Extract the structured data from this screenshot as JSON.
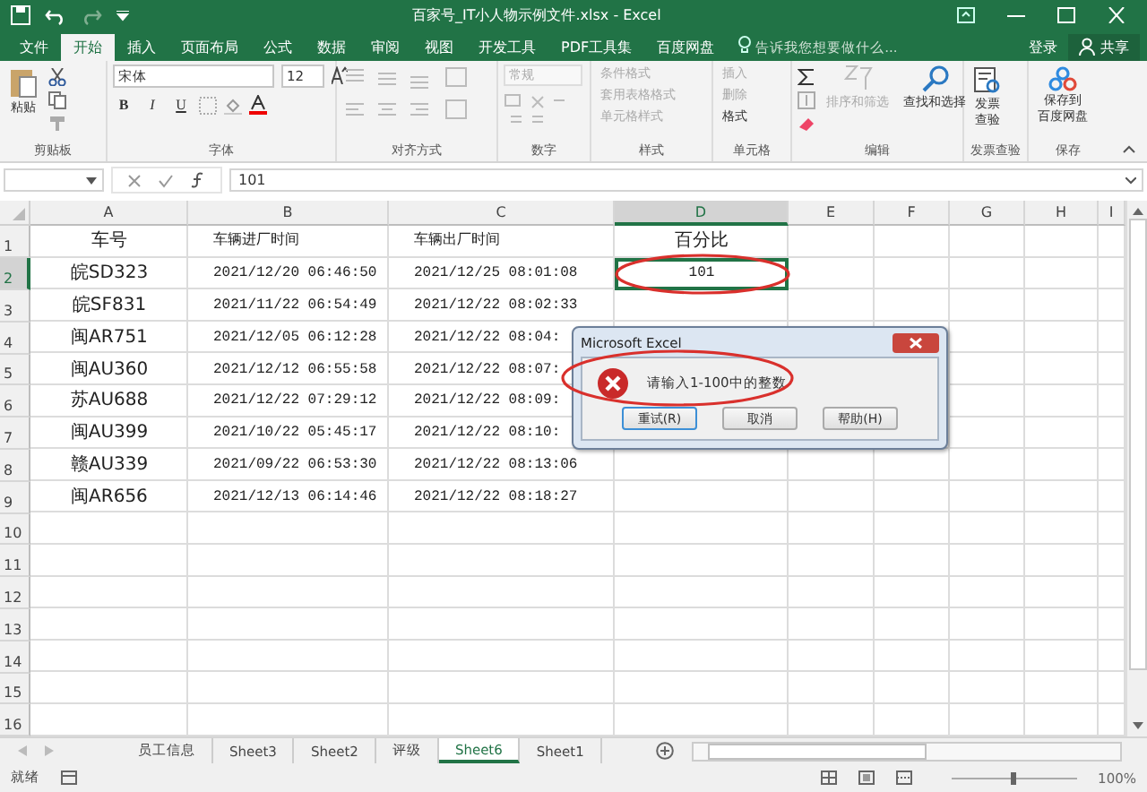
{
  "window": {
    "title": "百家号_IT小人物示例文件.xlsx - Excel"
  },
  "ribbon_tabs": [
    {
      "label": "文件",
      "selected": false
    },
    {
      "label": "开始",
      "selected": true
    },
    {
      "label": "插入",
      "selected": false
    },
    {
      "label": "页面布局",
      "selected": false
    },
    {
      "label": "公式",
      "selected": false
    },
    {
      "label": "数据",
      "selected": false
    },
    {
      "label": "审阅",
      "selected": false
    },
    {
      "label": "视图",
      "selected": false
    },
    {
      "label": "开发工具",
      "selected": false
    },
    {
      "label": "PDF工具集",
      "selected": false
    },
    {
      "label": "百度网盘",
      "selected": false
    }
  ],
  "tell_me": {
    "placeholder": "告诉我您想要做什么..."
  },
  "account": {
    "login": "登录",
    "share": "共享"
  },
  "ribbon": {
    "clipboard": {
      "label": "剪贴板",
      "paste": "粘贴"
    },
    "font": {
      "label": "字体",
      "font_name": "宋体",
      "font_size": "12",
      "bold": "B",
      "italic": "I",
      "underline": "U"
    },
    "alignment": {
      "label": "对齐方式"
    },
    "number": {
      "label": "数字",
      "format": "常规"
    },
    "styles": {
      "label": "样式",
      "items": [
        {
          "label": "条件格式",
          "disabled": true
        },
        {
          "label": "套用表格格式",
          "disabled": true
        },
        {
          "label": "单元格样式",
          "disabled": true
        }
      ]
    },
    "cells": {
      "label": "单元格",
      "items": [
        {
          "label": "插入",
          "disabled": true
        },
        {
          "label": "删除",
          "disabled": true
        },
        {
          "label": "格式",
          "disabled": false
        }
      ]
    },
    "editing": {
      "label": "编辑",
      "items": [
        {
          "label": "排序和筛选",
          "disabled": true
        },
        {
          "label": "查找和选择",
          "disabled": false
        }
      ]
    },
    "invoice": {
      "label": "发票查验",
      "button": [
        "发票",
        "查验"
      ]
    },
    "save": {
      "label": "保存",
      "button": [
        "保存到",
        "百度网盘"
      ]
    }
  },
  "formula_bar": {
    "value": "101"
  },
  "columns": [
    {
      "label": "A",
      "selected": false
    },
    {
      "label": "B",
      "selected": false
    },
    {
      "label": "C",
      "selected": false
    },
    {
      "label": "D",
      "selected": true
    },
    {
      "label": "E",
      "selected": false
    },
    {
      "label": "F",
      "selected": false
    },
    {
      "label": "G",
      "selected": false
    },
    {
      "label": "H",
      "selected": false
    },
    {
      "label": "I",
      "selected": false
    }
  ],
  "rows": [
    {
      "header": "1",
      "selected": false,
      "cells": [
        {
          "text": "车号",
          "active": false
        },
        {
          "text": "车辆进厂时间",
          "active": false
        },
        {
          "text": "车辆出厂时间",
          "active": false
        },
        {
          "text": "百分比",
          "active": false
        }
      ]
    },
    {
      "header": "2",
      "selected": true,
      "cells": [
        {
          "text": "皖SD323",
          "active": false
        },
        {
          "text": "2021/12/20 06:46:50",
          "active": false
        },
        {
          "text": "2021/12/25 08:01:08",
          "active": false
        },
        {
          "text": "101",
          "active": true
        }
      ]
    },
    {
      "header": "3",
      "selected": false,
      "cells": [
        {
          "text": "皖SF831",
          "active": false
        },
        {
          "text": "2021/11/22 06:54:49",
          "active": false
        },
        {
          "text": "2021/12/22 08:02:33",
          "active": false
        }
      ]
    },
    {
      "header": "4",
      "selected": false,
      "cells": [
        {
          "text": "闽AR751",
          "active": false
        },
        {
          "text": "2021/12/05 06:12:28",
          "active": false
        },
        {
          "text": "2021/12/22 08:04:",
          "active": false
        }
      ]
    },
    {
      "header": "5",
      "selected": false,
      "cells": [
        {
          "text": "闽AU360",
          "active": false
        },
        {
          "text": "2021/12/12 06:55:58",
          "active": false
        },
        {
          "text": "2021/12/22 08:07:",
          "active": false
        }
      ]
    },
    {
      "header": "6",
      "selected": false,
      "cells": [
        {
          "text": "苏AU688",
          "active": false
        },
        {
          "text": "2021/12/22 07:29:12",
          "active": false
        },
        {
          "text": "2021/12/22 08:09:",
          "active": false
        }
      ]
    },
    {
      "header": "7",
      "selected": false,
      "cells": [
        {
          "text": "闽AU399",
          "active": false
        },
        {
          "text": "2021/10/22 05:45:17",
          "active": false
        },
        {
          "text": "2021/12/22 08:10:",
          "active": false
        }
      ]
    },
    {
      "header": "8",
      "selected": false,
      "cells": [
        {
          "text": "赣AU339",
          "active": false
        },
        {
          "text": "2021/09/22 06:53:30",
          "active": false
        },
        {
          "text": "2021/12/22 08:13:06",
          "active": false
        }
      ]
    },
    {
      "header": "9",
      "selected": false,
      "cells": [
        {
          "text": "闽AR656",
          "active": false
        },
        {
          "text": "2021/12/13 06:14:46",
          "active": false
        },
        {
          "text": "2021/12/22 08:18:27",
          "active": false
        }
      ]
    },
    {
      "header": "10",
      "selected": false
    },
    {
      "header": "11",
      "selected": false
    },
    {
      "header": "12",
      "selected": false
    },
    {
      "header": "13",
      "selected": false
    },
    {
      "header": "14",
      "selected": false
    },
    {
      "header": "15",
      "selected": false
    },
    {
      "header": "16",
      "selected": false
    }
  ],
  "dialog": {
    "title": "Microsoft Excel",
    "message": "请输入1-100中的整数",
    "buttons": [
      {
        "label": "重试(R)",
        "selected": true
      },
      {
        "label": "取消",
        "selected": false
      },
      {
        "label": "帮助(H)",
        "selected": false
      }
    ]
  },
  "sheet_tabs": [
    {
      "label": "员工信息",
      "selected": false
    },
    {
      "label": "Sheet3",
      "selected": false
    },
    {
      "label": "Sheet2",
      "selected": false
    },
    {
      "label": "评级",
      "selected": false
    },
    {
      "label": "Sheet6",
      "selected": true
    },
    {
      "label": "Sheet1",
      "selected": false
    }
  ],
  "status_bar": {
    "status": "就绪",
    "zoom_slider": {
      "level": 0.5
    },
    "zoom": "100%"
  }
}
